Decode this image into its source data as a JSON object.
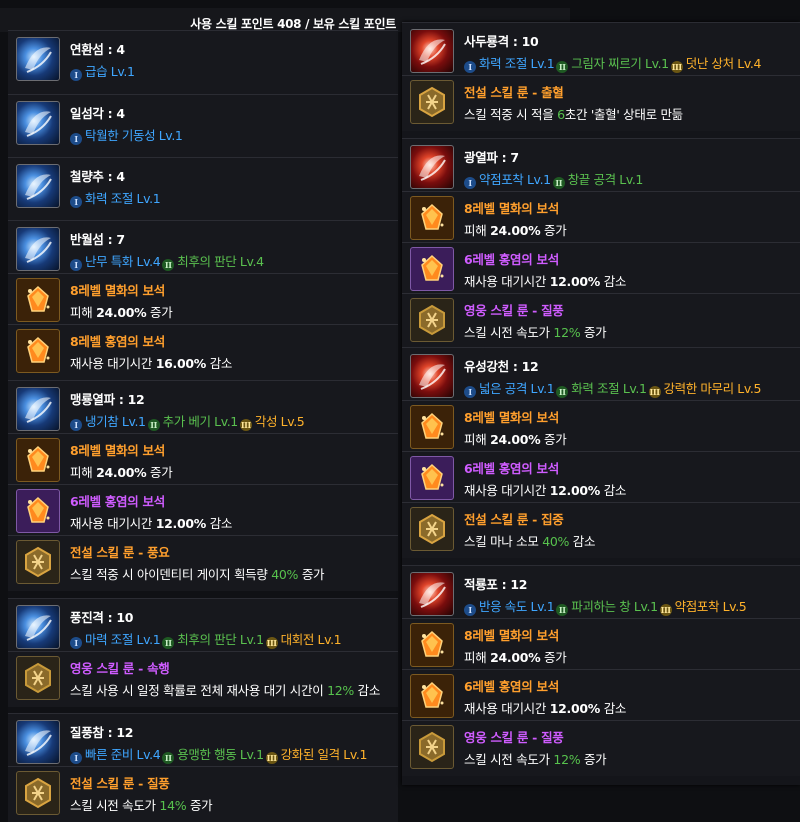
{
  "header": {
    "text": "사용 스킬 포인트 408 / 보유 스킬 포인트"
  },
  "left_skills": [
    {
      "name": "연환섬 : 4",
      "tripods": [
        {
          "tier": "I",
          "label": "급습 Lv.1"
        }
      ],
      "extras": []
    },
    {
      "name": "일섬각 : 4",
      "tripods": [
        {
          "tier": "I",
          "label": "탁월한 기동성 Lv.1"
        }
      ],
      "extras": []
    },
    {
      "name": "철량추 : 4",
      "tripods": [
        {
          "tier": "I",
          "label": "화력 조절 Lv.1"
        }
      ],
      "extras": []
    },
    {
      "name": "반월섬 : 7",
      "tripods": [
        {
          "tier": "I",
          "label": "난무 특화 Lv.4"
        },
        {
          "tier": "II",
          "label": "최후의 판단 Lv.4"
        }
      ],
      "extras": [
        {
          "kind": "gem-o",
          "title": "8레벨 멸화의 보석",
          "pre": "피해 ",
          "bold": "24.00%",
          "mid": " 증가",
          "post": ""
        },
        {
          "kind": "gem-o",
          "title": "8레벨 홍염의 보석",
          "pre": "재사용 대기시간 ",
          "bold": "16.00%",
          "mid": " 감소",
          "post": ""
        }
      ]
    },
    {
      "name": "맹룡열파 : 12",
      "tripods": [
        {
          "tier": "I",
          "label": "냉기참 Lv.1"
        },
        {
          "tier": "II",
          "label": "추가 베기 Lv.1"
        },
        {
          "tier": "III",
          "label": "각성 Lv.5"
        }
      ],
      "extras": [
        {
          "kind": "gem-o",
          "title": "8레벨 멸화의 보석",
          "pre": "피해 ",
          "bold": "24.00%",
          "mid": " 증가",
          "post": ""
        },
        {
          "kind": "gem-p",
          "title": "6레벨 홍염의 보석",
          "pre": "재사용 대기시간 ",
          "bold": "12.00%",
          "mid": " 감소",
          "post": ""
        },
        {
          "kind": "rune-o",
          "title": "전설 스킬 룬 - 풍요",
          "pre": "스킬 적중 시 아이덴티티 게이지 획득량 ",
          "bold": "",
          "green": "40%",
          "mid": " 증가",
          "post": ""
        }
      ]
    },
    {
      "name": "풍진격 : 10",
      "tripods": [
        {
          "tier": "I",
          "label": "마력 조절 Lv.1"
        },
        {
          "tier": "II",
          "label": "최후의 판단 Lv.1"
        },
        {
          "tier": "III",
          "label": "대회전 Lv.1"
        }
      ],
      "extras": [
        {
          "kind": "rune-p",
          "title": "영웅 스킬 룬 - 속행",
          "pre": "스킬 사용 시 일정 확률로 전체 재사용 대기 시간이 ",
          "bold": "",
          "green": "12%",
          "mid": " 감소",
          "post": ""
        }
      ]
    },
    {
      "name": "질풍참 : 12",
      "tripods": [
        {
          "tier": "I",
          "label": "빠른 준비 Lv.4"
        },
        {
          "tier": "II",
          "label": "용맹한 행동 Lv.1"
        },
        {
          "tier": "III",
          "label": "강화된 일격 Lv.1"
        }
      ],
      "extras": [
        {
          "kind": "rune-o",
          "title": "전설 스킬 룬 - 질풍",
          "pre": "스킬 시전 속도가 ",
          "bold": "",
          "green": "14%",
          "mid": " 증가",
          "post": ""
        }
      ]
    }
  ],
  "right_skills": [
    {
      "name": "사두룡격 : 10",
      "tripods": [
        {
          "tier": "I",
          "label": "화력 조절 Lv.1"
        },
        {
          "tier": "II",
          "label": "그림자 찌르기 Lv.1"
        },
        {
          "tier": "III",
          "label": "덧난 상처 Lv.4"
        }
      ],
      "extras": [
        {
          "kind": "rune-o",
          "title": "전설 스킬 룬 - 출혈",
          "pre": "스킬 적중 시 적을 ",
          "bold": "",
          "green": "6",
          "mid": "초간 '출혈' 상태로 만듦",
          "post": ""
        }
      ]
    },
    {
      "name": "광열파 : 7",
      "tripods": [
        {
          "tier": "I",
          "label": "약점포착 Lv.1"
        },
        {
          "tier": "II",
          "label": "창끝 공격 Lv.1"
        }
      ],
      "extras": [
        {
          "kind": "gem-o",
          "title": "8레벨 멸화의 보석",
          "pre": "피해 ",
          "bold": "24.00%",
          "mid": " 증가",
          "post": ""
        },
        {
          "kind": "gem-p",
          "title": "6레벨 홍염의 보석",
          "pre": "재사용 대기시간 ",
          "bold": "12.00%",
          "mid": " 감소",
          "post": ""
        },
        {
          "kind": "rune-p",
          "title": "영웅 스킬 룬 - 질풍",
          "pre": "스킬 시전 속도가 ",
          "bold": "",
          "green": "12%",
          "mid": " 증가",
          "post": ""
        }
      ]
    },
    {
      "name": "유성강천 : 12",
      "tripods": [
        {
          "tier": "I",
          "label": "넓은 공격 Lv.1"
        },
        {
          "tier": "II",
          "label": "화력 조절 Lv.1"
        },
        {
          "tier": "III",
          "label": "강력한 마무리 Lv.5"
        }
      ],
      "extras": [
        {
          "kind": "gem-o",
          "title": "8레벨 멸화의 보석",
          "pre": "피해 ",
          "bold": "24.00%",
          "mid": " 증가",
          "post": ""
        },
        {
          "kind": "gem-p",
          "title": "6레벨 홍염의 보석",
          "pre": "재사용 대기시간 ",
          "bold": "12.00%",
          "mid": " 감소",
          "post": ""
        },
        {
          "kind": "rune-o",
          "title": "전설 스킬 룬 - 집중",
          "pre": "스킬 마나 소모 ",
          "bold": "",
          "green": "40%",
          "mid": " 감소",
          "post": ""
        }
      ]
    },
    {
      "name": "적룡포 : 12",
      "tripods": [
        {
          "tier": "I",
          "label": "반응 속도 Lv.1"
        },
        {
          "tier": "II",
          "label": "파괴하는 창 Lv.1"
        },
        {
          "tier": "III",
          "label": "약점포착 Lv.5"
        }
      ],
      "extras": [
        {
          "kind": "gem-o",
          "title": "8레벨 멸화의 보석",
          "pre": "피해 ",
          "bold": "24.00%",
          "mid": " 증가",
          "post": ""
        },
        {
          "kind": "gem-o",
          "title": "6레벨 홍염의 보석",
          "pre": "재사용 대기시간 ",
          "bold": "12.00%",
          "mid": " 감소",
          "post": ""
        },
        {
          "kind": "rune-p",
          "title": "영웅 스킬 룬 - 질풍",
          "pre": "스킬 시전 속도가 ",
          "bold": "",
          "green": "12%",
          "mid": " 증가",
          "post": ""
        }
      ]
    }
  ],
  "colors": {
    "legendary": "#ff9f2d",
    "heroic": "#cf5cff",
    "tripod_1": "#3fa6ff",
    "tripod_2": "#5ac04f",
    "tripod_3": "#ffb22b",
    "bonus": "#57c24d"
  },
  "icons": {
    "skill": "skill-icon",
    "gem": "gem-icon",
    "rune": "rune-icon",
    "tier1": "tripod-tier-1-icon",
    "tier2": "tripod-tier-2-icon",
    "tier3": "tripod-tier-3-icon"
  }
}
